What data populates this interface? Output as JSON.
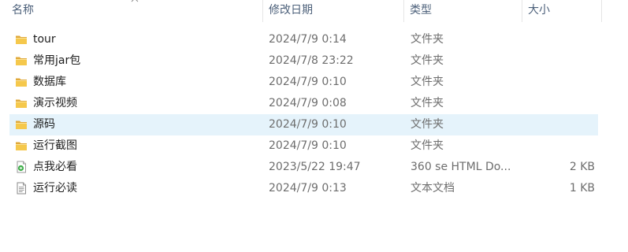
{
  "columns": {
    "name": "名称",
    "modified": "修改日期",
    "type": "类型",
    "size": "大小"
  },
  "files": [
    {
      "name": "tour",
      "modified": "2024/7/9 0:14",
      "type": "文件夹",
      "size": "",
      "icon": "folder-icon",
      "selected": false
    },
    {
      "name": "常用jar包",
      "modified": "2024/7/8 23:22",
      "type": "文件夹",
      "size": "",
      "icon": "folder-icon",
      "selected": false
    },
    {
      "name": "数据库",
      "modified": "2024/7/9 0:10",
      "type": "文件夹",
      "size": "",
      "icon": "folder-icon",
      "selected": false
    },
    {
      "name": "演示视频",
      "modified": "2024/7/9 0:08",
      "type": "文件夹",
      "size": "",
      "icon": "folder-icon",
      "selected": false
    },
    {
      "name": "源码",
      "modified": "2024/7/9 0:10",
      "type": "文件夹",
      "size": "",
      "icon": "folder-icon",
      "selected": true
    },
    {
      "name": "运行截图",
      "modified": "2024/7/9 0:10",
      "type": "文件夹",
      "size": "",
      "icon": "folder-icon",
      "selected": false
    },
    {
      "name": "点我必看",
      "modified": "2023/5/22 19:47",
      "type": "360 se HTML Do...",
      "size": "2 KB",
      "icon": "html-document-icon",
      "selected": false
    },
    {
      "name": "运行必读",
      "modified": "2024/7/9 0:13",
      "type": "文本文档",
      "size": "1 KB",
      "icon": "text-document-icon",
      "selected": false
    }
  ],
  "colors": {
    "header_text": "#4c607a",
    "selection": "#e5f3fb",
    "folder": "#f5c84c"
  }
}
